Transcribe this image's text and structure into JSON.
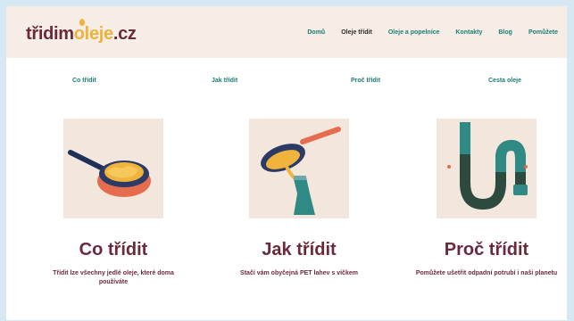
{
  "logo": {
    "part1": "třidim",
    "part2": "oleje",
    "part3": ".cz"
  },
  "nav": {
    "items": [
      "Domů",
      "Oleje třídit",
      "Oleje a popelníce",
      "Kontakty",
      "Blog",
      "Pomůžete"
    ]
  },
  "subnav": {
    "items": [
      "Co třídit",
      "Jak třídit",
      "Proč třídit",
      "Cesta oleje"
    ]
  },
  "cards": [
    {
      "title": "Co třídit",
      "text": "Třídit lze všechny jedlé oleje, které doma používáte"
    },
    {
      "title": "Jak třídit",
      "text": "Stačí vám obyčejná PET lahev s víčkem"
    },
    {
      "title": "Proč třídit",
      "text": "Pomůžete ušetřit odpadní potrubí i naši planetu"
    }
  ],
  "colors": {
    "brand": "#6b2a3c",
    "accent": "#f1b13b",
    "teal": "#1d7c74",
    "header_bg": "#f6eee6"
  }
}
